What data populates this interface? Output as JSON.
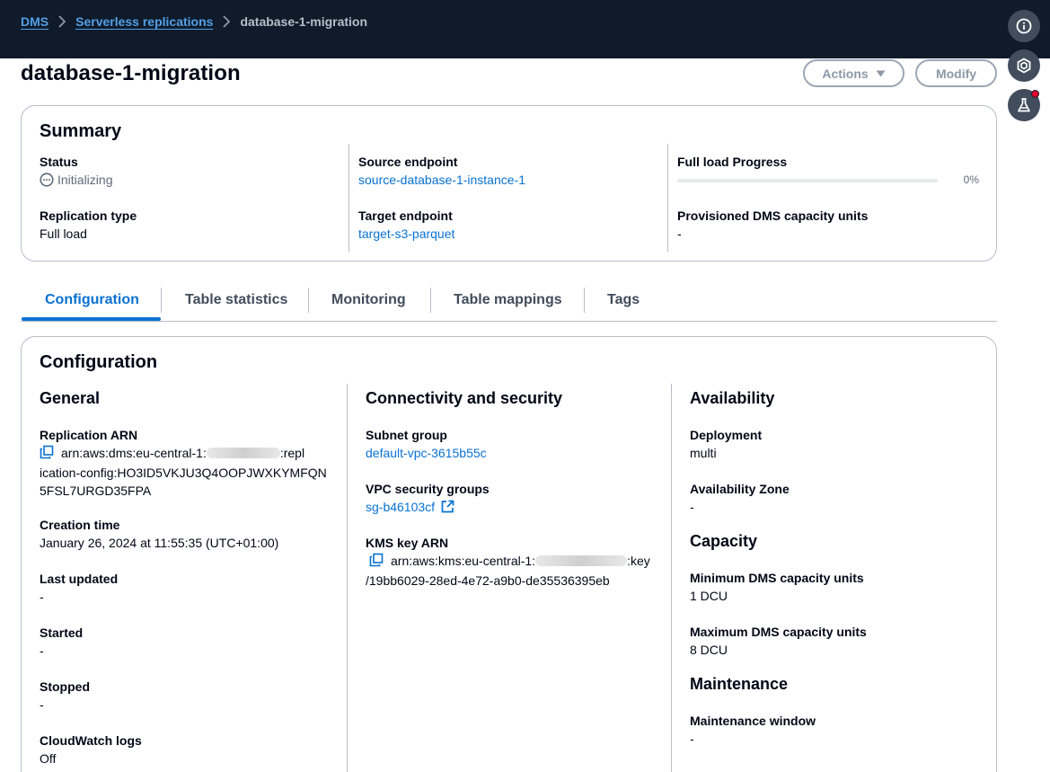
{
  "breadcrumb": {
    "root": "DMS",
    "parent": "Serverless replications",
    "current": "database-1-migration"
  },
  "header": {
    "title": "database-1-migration",
    "actions_label": "Actions",
    "modify_label": "Modify"
  },
  "summary": {
    "title": "Summary",
    "status_label": "Status",
    "status_value": "Initializing",
    "replication_type_label": "Replication type",
    "replication_type_value": "Full load",
    "source_endpoint_label": "Source endpoint",
    "source_endpoint_value": "source-database-1-instance-1",
    "target_endpoint_label": "Target endpoint",
    "target_endpoint_value": "target-s3-parquet",
    "full_load_label": "Full load Progress",
    "full_load_value": "0%",
    "full_load_fraction": 0,
    "capacity_label": "Provisioned DMS capacity units",
    "capacity_value": "-"
  },
  "tabs": [
    "Configuration",
    "Table statistics",
    "Monitoring",
    "Table mappings",
    "Tags"
  ],
  "config": {
    "title": "Configuration",
    "general": {
      "heading": "General",
      "arn_label": "Replication ARN",
      "arn_prefix": "arn:aws:dms:eu-central-1:",
      "arn_suffix": ":repl",
      "arn_line2": "ication-config:HO3ID5VKJU3Q4OOPJWXKYMFQN",
      "arn_line3": "5FSL7URGD35FPA",
      "creation_label": "Creation time",
      "creation_value": "January 26, 2024 at 11:55:35 (UTC+01:00)",
      "updated_label": "Last updated",
      "updated_value": "-",
      "started_label": "Started",
      "started_value": "-",
      "stopped_label": "Stopped",
      "stopped_value": "-",
      "cloudwatch_label": "CloudWatch logs",
      "cloudwatch_value": "Off"
    },
    "connectivity": {
      "heading": "Connectivity and security",
      "subnet_label": "Subnet group",
      "subnet_value": "default-vpc-3615b55c",
      "vpc_sg_label": "VPC security groups",
      "vpc_sg_value": "sg-b46103cf",
      "kms_label": "KMS key ARN",
      "kms_prefix": "arn:aws:kms:eu-central-1:",
      "kms_suffix": ":key",
      "kms_line2": "/19bb6029-28ed-4e72-a9b0-de35536395eb"
    },
    "availability": {
      "heading": "Availability",
      "deployment_label": "Deployment",
      "deployment_value": "multi",
      "az_label": "Availability Zone",
      "az_value": "-",
      "capacity_heading": "Capacity",
      "min_label": "Minimum DMS capacity units",
      "min_value": "1 DCU",
      "max_label": "Maximum DMS capacity units",
      "max_value": "8 DCU",
      "maintenance_heading": "Maintenance",
      "window_label": "Maintenance window",
      "window_value": "-"
    }
  },
  "icons": {
    "info": "info-icon",
    "settings": "hexagon-settings-icon",
    "labs": "flask-icon"
  },
  "colors": {
    "topbar": "#0f1b2a",
    "link": "#0972d3",
    "notification": "#e0002b"
  }
}
